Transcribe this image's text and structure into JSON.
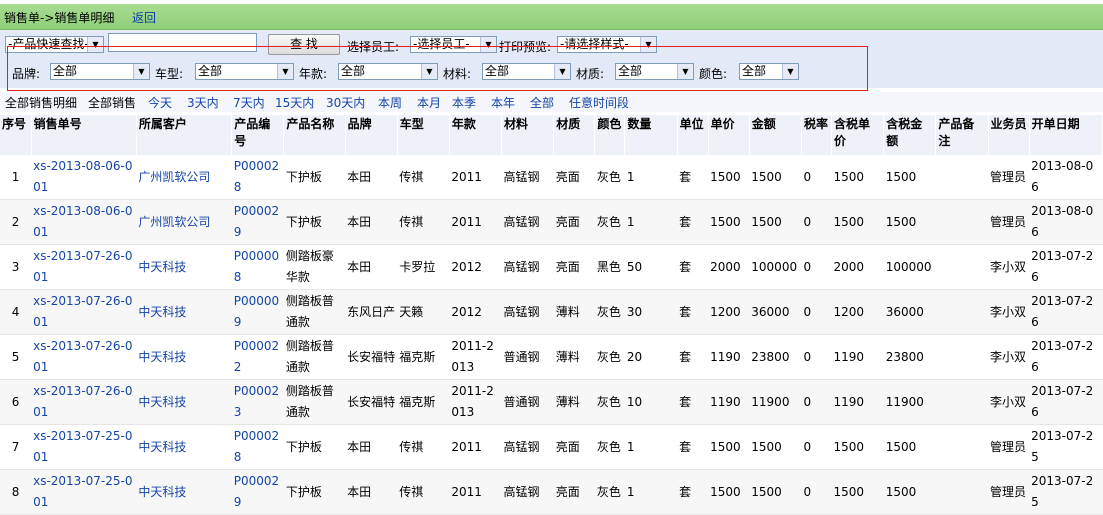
{
  "titlebar": {
    "path": "销售单->销售单明细",
    "back": "返回"
  },
  "filters": {
    "quick_find": "-产品快速查找-",
    "search_value": "",
    "search_button": "查 找",
    "staff_label": "选择员工:",
    "staff_value": "-选择员工-",
    "print_label": "打印预览:",
    "print_value": "-请选择样式-",
    "brand_label": "品牌:",
    "brand_value": "全部",
    "model_label": "车型:",
    "model_value": "全部",
    "year_label": "年款:",
    "year_value": "全部",
    "material_label": "材料:",
    "material_value": "全部",
    "texture_label": "材质:",
    "texture_value": "全部",
    "color_label": "颜色:",
    "color_value": "全部"
  },
  "quick": [
    "全部销售明细",
    "全部销售",
    "今天",
    "3天内",
    "7天内",
    "15天内",
    "30天内",
    "本周",
    "本月",
    "本季",
    "本年",
    "全部",
    "任意时间段"
  ],
  "table": {
    "headers": [
      "序号",
      "销售单号",
      "所属客户",
      "产品编号",
      "产品名称",
      "品牌",
      "车型",
      "年款",
      "材料",
      "材质",
      "颜色",
      "数量",
      "单位",
      "单价",
      "金额",
      "税率",
      "含税单价",
      "含税金额",
      "产品备注",
      "业务员",
      "开单日期"
    ],
    "rows": [
      [
        "1",
        "xs-2013-08-06-001",
        "广州凯软公司",
        "P000028",
        "下护板",
        "本田",
        "传祺",
        "2011",
        "高锰钢",
        "亮面",
        "灰色",
        "1",
        "套",
        "1500",
        "1500",
        "0",
        "1500",
        "1500",
        "",
        "管理员",
        "2013-08-06"
      ],
      [
        "2",
        "xs-2013-08-06-001",
        "广州凯软公司",
        "P000029",
        "下护板",
        "本田",
        "传祺",
        "2011",
        "高锰钢",
        "亮面",
        "灰色",
        "1",
        "套",
        "1500",
        "1500",
        "0",
        "1500",
        "1500",
        "",
        "管理员",
        "2013-08-06"
      ],
      [
        "3",
        "xs-2013-07-26-001",
        "中天科技",
        "P000008",
        "侧踏板豪华款",
        "本田",
        "卡罗拉",
        "2012",
        "高锰钢",
        "亮面",
        "黑色",
        "50",
        "套",
        "2000",
        "100000",
        "0",
        "2000",
        "100000",
        "",
        "李小双",
        "2013-07-26"
      ],
      [
        "4",
        "xs-2013-07-26-001",
        "中天科技",
        "P000009",
        "侧踏板普通款",
        "东风日产",
        "天籁",
        "2012",
        "高锰钢",
        "薄料",
        "灰色",
        "30",
        "套",
        "1200",
        "36000",
        "0",
        "1200",
        "36000",
        "",
        "李小双",
        "2013-07-26"
      ],
      [
        "5",
        "xs-2013-07-26-001",
        "中天科技",
        "P000022",
        "侧踏板普通款",
        "长安福特",
        "福克斯",
        "2011-2013",
        "普通钢",
        "薄料",
        "灰色",
        "20",
        "套",
        "1190",
        "23800",
        "0",
        "1190",
        "23800",
        "",
        "李小双",
        "2013-07-26"
      ],
      [
        "6",
        "xs-2013-07-26-001",
        "中天科技",
        "P000023",
        "侧踏板普通款",
        "长安福特",
        "福克斯",
        "2011-2013",
        "普通钢",
        "薄料",
        "灰色",
        "10",
        "套",
        "1190",
        "11900",
        "0",
        "1190",
        "11900",
        "",
        "李小双",
        "2013-07-26"
      ],
      [
        "7",
        "xs-2013-07-25-001",
        "中天科技",
        "P000028",
        "下护板",
        "本田",
        "传祺",
        "2011",
        "高锰钢",
        "亮面",
        "灰色",
        "1",
        "套",
        "1500",
        "1500",
        "0",
        "1500",
        "1500",
        "",
        "管理员",
        "2013-07-25"
      ],
      [
        "8",
        "xs-2013-07-25-001",
        "中天科技",
        "P000029",
        "下护板",
        "本田",
        "传祺",
        "2011",
        "高锰钢",
        "亮面",
        "灰色",
        "1",
        "套",
        "1500",
        "1500",
        "0",
        "1500",
        "1500",
        "",
        "管理员",
        "2013-07-25"
      ]
    ]
  }
}
